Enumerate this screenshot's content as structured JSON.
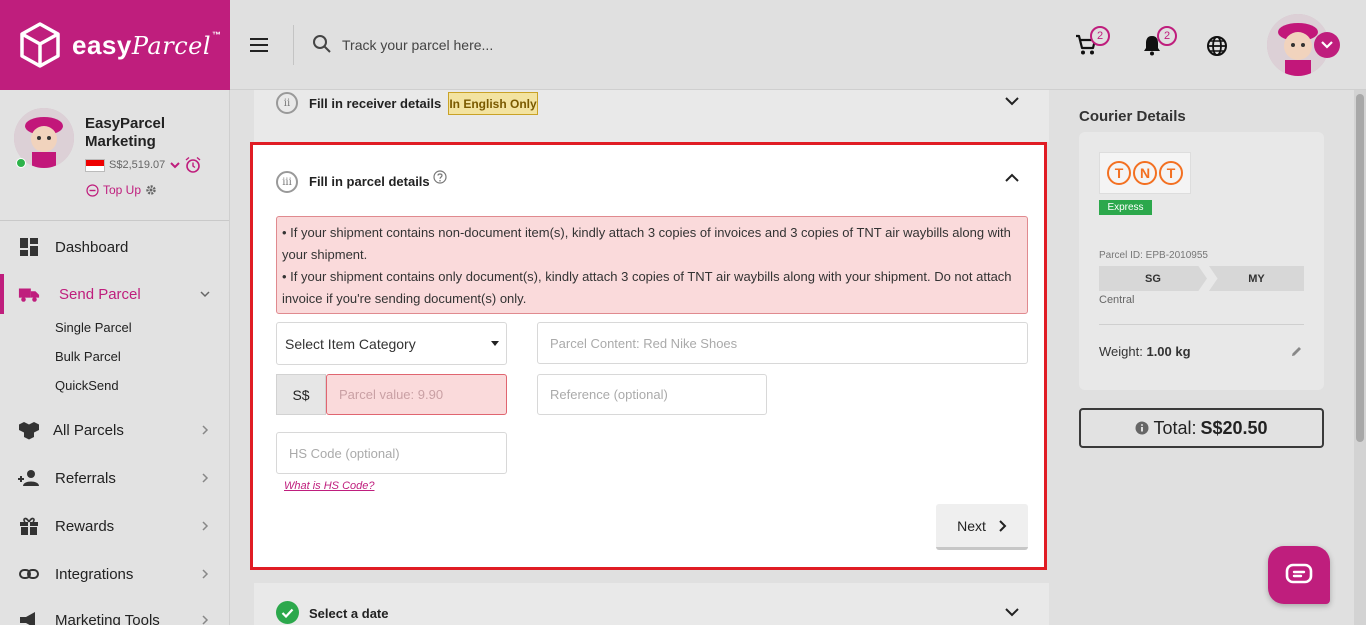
{
  "brand": {
    "name": "easy",
    "script": "Parcel",
    "tm": "™",
    "accent": "#bf1e7d"
  },
  "header": {
    "search_placeholder": "Track your parcel here...",
    "cart_count": "2",
    "notification_count": "2"
  },
  "profile": {
    "name": "EasyParcel Marketing",
    "balance": "S$2,519.07",
    "topup_label": "Top Up"
  },
  "sidebar": {
    "items": [
      {
        "label": "Dashboard"
      },
      {
        "label": "Send Parcel",
        "active": true
      },
      {
        "label": "All Parcels"
      },
      {
        "label": "Referrals"
      },
      {
        "label": "Rewards"
      },
      {
        "label": "Integrations"
      },
      {
        "label": "Marketing Tools"
      }
    ],
    "send_parcel_sub": [
      "Single Parcel",
      "Bulk Parcel",
      "QuickSend"
    ]
  },
  "steps": {
    "receiver": {
      "number": "ii",
      "title": "Fill in receiver details",
      "badge": "In English Only"
    },
    "parcel": {
      "number": "iii",
      "title": "Fill in parcel details",
      "notice": [
        "• If your shipment contains non-document item(s), kindly attach 3 copies of invoices and 3 copies of TNT air waybills along with your shipment.",
        "• If your shipment contains only document(s), kindly attach 3 copies of TNT air waybills along with your shipment. Do not attach invoice if you're sending document(s) only."
      ],
      "category_selected": "Select Item Category",
      "content_placeholder": "Parcel Content: Red Nike Shoes",
      "currency": "S$",
      "value_placeholder": "Parcel value: 9.90",
      "reference_placeholder": "Reference (optional)",
      "hs_placeholder": "HS Code (optional)",
      "hs_link": "What is HS Code?",
      "next_label": "Next"
    },
    "date": {
      "title": "Select a date"
    }
  },
  "courier": {
    "heading": "Courier Details",
    "logo_letters": [
      "T",
      "N",
      "T"
    ],
    "service": "Express",
    "parcel_id": "Parcel ID: EPB-2010955",
    "from": "SG",
    "to": "MY",
    "region": "Central",
    "weight_label": "Weight:",
    "weight_value": "1.00 kg",
    "total_label": "Total:",
    "total_value": "S$20.50"
  }
}
